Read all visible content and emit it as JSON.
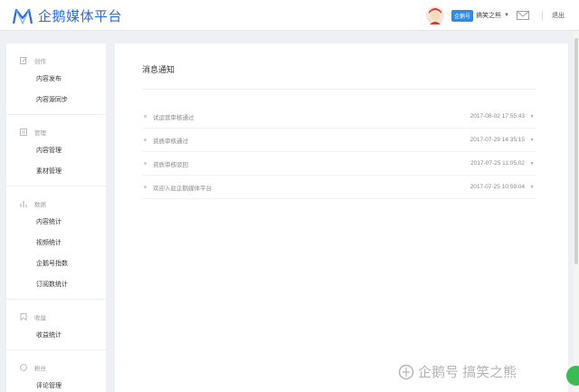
{
  "header": {
    "logo_text": "企鹅媒体平台",
    "badge": "企鹅号",
    "username": "搞笑之熊",
    "logout": "退出"
  },
  "sidebar": {
    "groups": [
      {
        "label": "创作",
        "icon": "edit-icon",
        "items": [
          {
            "label": "内容发布"
          },
          {
            "label": "内容源同步"
          }
        ]
      },
      {
        "label": "管理",
        "icon": "document-icon",
        "items": [
          {
            "label": "内容管理"
          },
          {
            "label": "素材管理"
          }
        ]
      },
      {
        "label": "数据",
        "icon": "bar-chart-icon",
        "items": [
          {
            "label": "内容统计"
          },
          {
            "label": "视频统计"
          },
          {
            "label": "企鹅号指数"
          },
          {
            "label": "订阅数统计"
          }
        ]
      },
      {
        "label": "收益",
        "icon": "bookmark-icon",
        "items": [
          {
            "label": "收益统计"
          }
        ]
      },
      {
        "label": "粉丝",
        "icon": "circle-icon",
        "items": [
          {
            "label": "评论管理"
          }
        ]
      }
    ]
  },
  "main": {
    "title": "消息通知",
    "notices": [
      {
        "text": "试运营审核通过",
        "time": "2017-08-02 17:55:43"
      },
      {
        "text": "资质审核通过",
        "time": "2017-07-29 14:35:15"
      },
      {
        "text": "资质审核驳回",
        "time": "2017-07-25 11:05:02"
      },
      {
        "text": "欢迎入驻企鹅媒体平台",
        "time": "2017-07-25 10:59:04"
      }
    ]
  },
  "watermark": {
    "text": "企鹅号 搞笑之熊"
  },
  "colors": {
    "brand": "#2b6bd6",
    "badge": "#2e8ae6",
    "page_bg": "#eef0f3"
  }
}
